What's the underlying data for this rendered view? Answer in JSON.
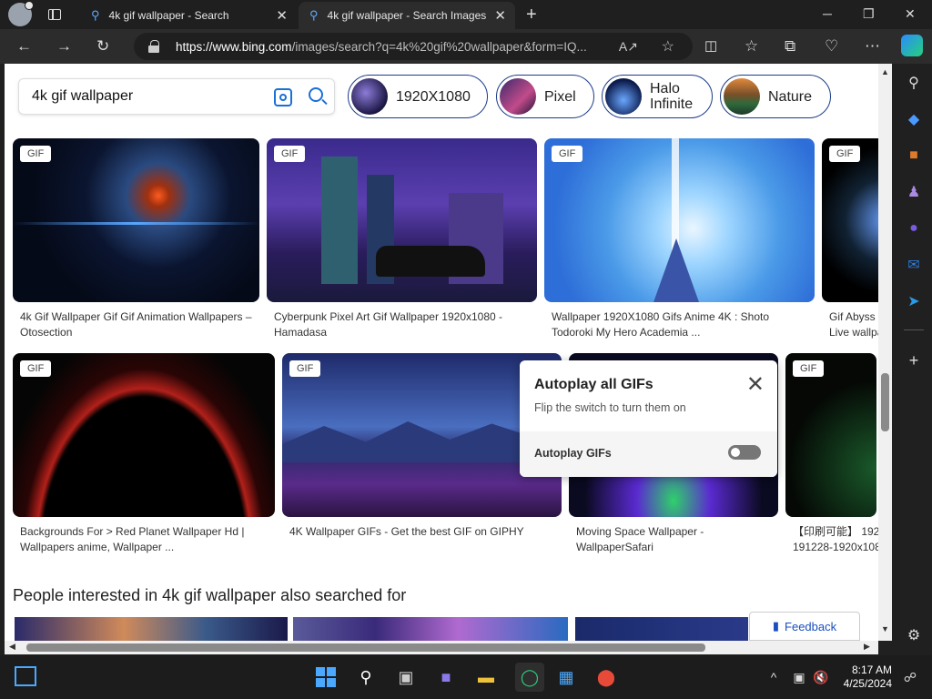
{
  "browser": {
    "tabs": [
      {
        "title": "4k gif wallpaper - Search"
      },
      {
        "title": "4k gif wallpaper - Search Images"
      }
    ],
    "url_domain": "https://www.bing.com",
    "url_path": "/images/search?q=4k%20gif%20wallpaper&form=IQ..."
  },
  "search": {
    "query": "4k gif wallpaper"
  },
  "chips": [
    {
      "label": "1920X1080"
    },
    {
      "label": "Pixel"
    },
    {
      "label": "Halo Infinite"
    },
    {
      "label": "Nature"
    }
  ],
  "results": [
    {
      "badge": "GIF",
      "caption1": "4k Gif Wallpaper Gif Gif Animation Wallpapers –",
      "caption2": "Otosection"
    },
    {
      "badge": "GIF",
      "caption1": "Cyberpunk Pixel Art Gif Wallpaper 1920x1080 -",
      "caption2": "Hamadasa"
    },
    {
      "badge": "GIF",
      "caption1": "Wallpaper 1920X1080 Gifs Anime 4K : Shoto",
      "caption2": "Todoroki My Hero Academia ..."
    },
    {
      "badge": "GIF",
      "caption1": "Gif Abyss",
      "caption2": "Live wallpa"
    },
    {
      "badge": "GIF",
      "caption1": "Backgrounds For > Red Planet Wallpaper Hd |",
      "caption2": "Wallpapers anime, Wallpaper ..."
    },
    {
      "badge": "GIF",
      "caption1": "4K Wallpaper GIFs - Get the best GIF on GIPHY",
      "caption2": ""
    },
    {
      "badge": "",
      "caption1": "Moving Space Wallpaper -",
      "caption2": "WallpaperSafari"
    },
    {
      "badge": "GIF",
      "caption1": "【印刷可能】 192",
      "caption2": "191228-1920x108"
    }
  ],
  "related_heading": "People interested in 4k gif wallpaper also searched for",
  "popup": {
    "title": "Autoplay all GIFs",
    "subtitle": "Flip the switch to turn them on",
    "toggle_label": "Autoplay GIFs",
    "toggle_on": false
  },
  "feedback_label": "Feedback",
  "clock": {
    "time": "8:17 AM",
    "date": "4/25/2024"
  }
}
